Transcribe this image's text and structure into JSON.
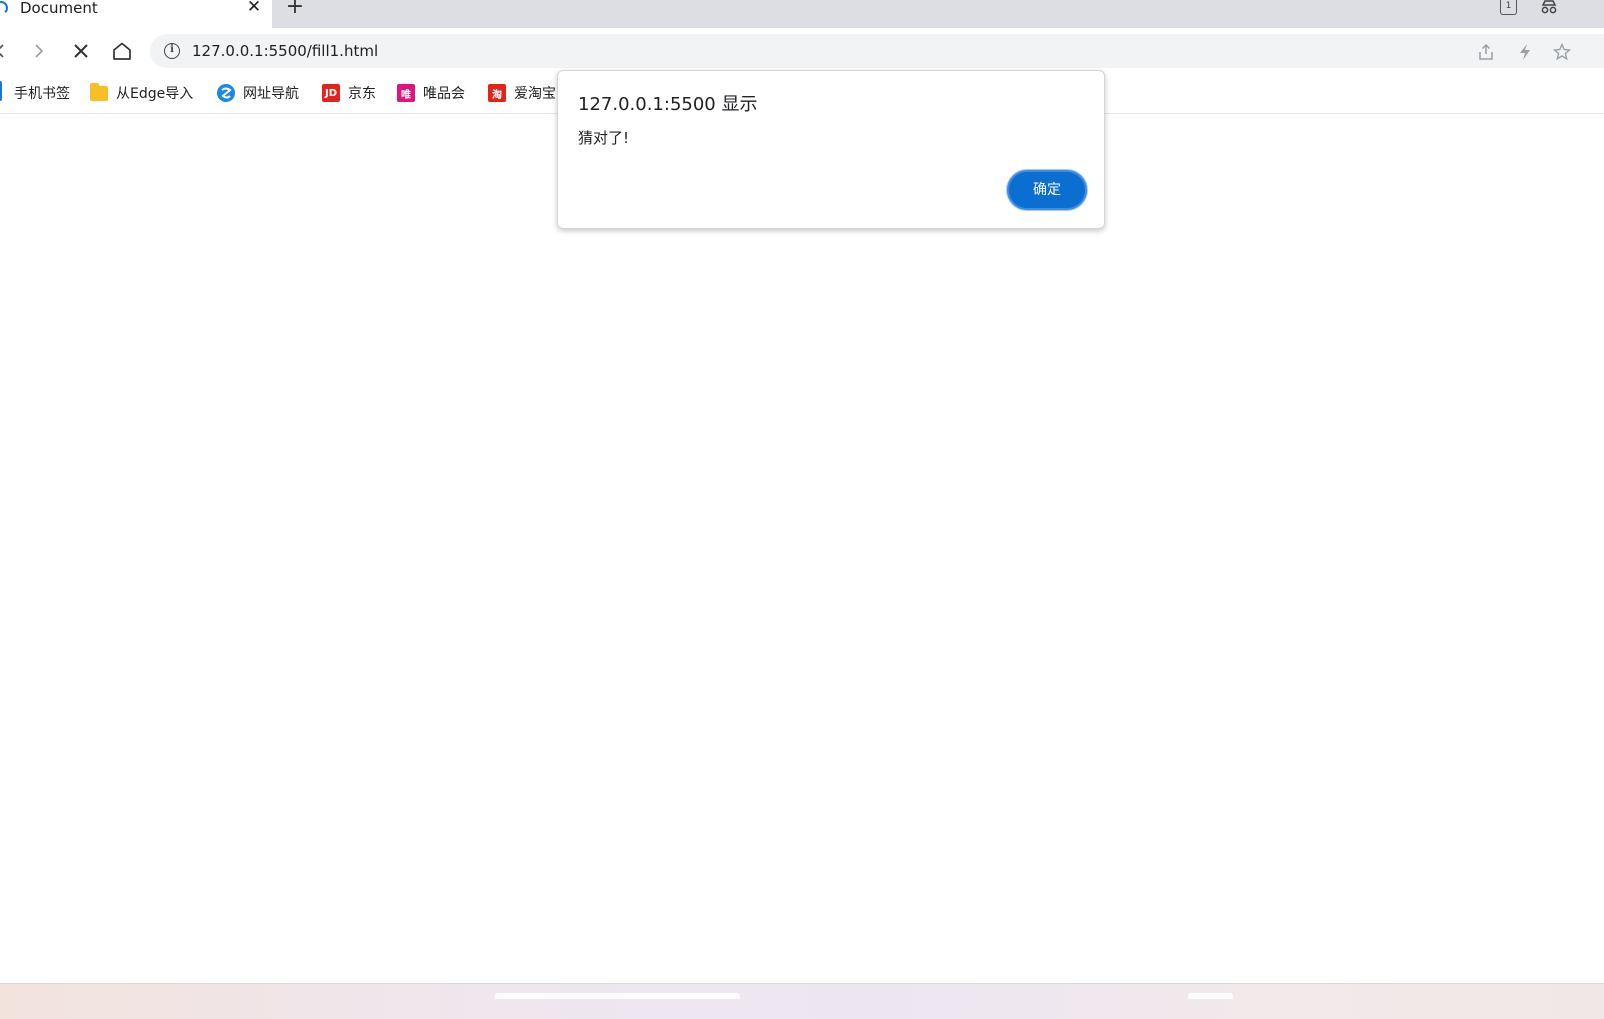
{
  "tab": {
    "title": "Document",
    "close_glyph": "✕",
    "new_tab_glyph": "+"
  },
  "tabstrip": {
    "tab_count": "1"
  },
  "toolbar": {
    "url": "127.0.0.1:5500/fill1.html"
  },
  "bookmarks": [
    {
      "label": "手机书签",
      "icon": "mobile-icon"
    },
    {
      "label": "从Edge导入",
      "icon": "folder-icon"
    },
    {
      "label": "网址导航",
      "icon": "nav-icon"
    },
    {
      "label": "京东",
      "icon": "jd-icon",
      "icon_text": "JD",
      "color": "#e1251b"
    },
    {
      "label": "唯品会",
      "icon": "vip-icon",
      "icon_text": "唯",
      "color": "#df147f"
    },
    {
      "label": "爱淘宝",
      "icon": "taobao-icon",
      "icon_text": "淘",
      "color": "#e1251b"
    }
  ],
  "dialog": {
    "title": "127.0.0.1:5500 显示",
    "message": "猜对了!",
    "ok_label": "确定",
    "accent_color": "#0b6fd1"
  }
}
